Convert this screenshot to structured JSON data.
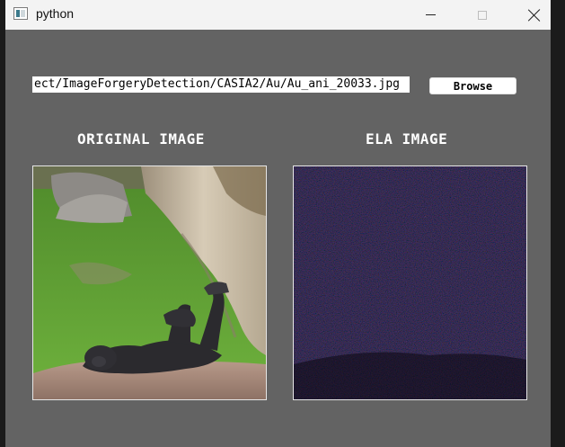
{
  "window": {
    "title": "python",
    "controls": {
      "minimize": "minimize-icon",
      "maximize": "maximize-icon",
      "close": "close-icon"
    }
  },
  "form": {
    "path_value": "ect/ImageForgeryDetection/CASIA2/Au/Au_ani_20033.jpg",
    "browse_label": "Browse"
  },
  "panels": {
    "original_heading": "ORIGINAL IMAGE",
    "ela_heading": "ELA IMAGE"
  },
  "colors": {
    "background": "#636363",
    "titlebar": "#f3f3f3",
    "ela_base": "#070311"
  }
}
